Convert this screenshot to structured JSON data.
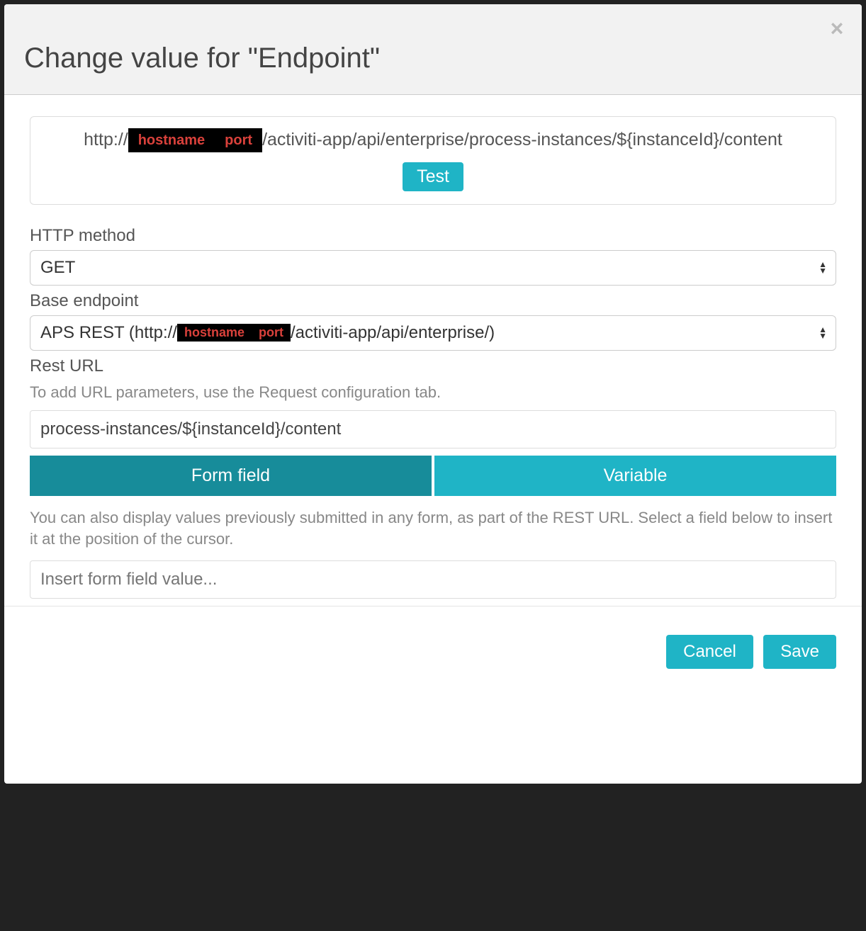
{
  "modal": {
    "title": "Change value for \"Endpoint\"",
    "url_prefix": "http://",
    "redacted_host_label": "hostname",
    "redacted_port_label": "port",
    "url_path_1": "/activiti-app/api/enterprise/process-instances/${instanceId}/content",
    "test_label": "Test",
    "http_method": {
      "label": "HTTP method",
      "value": "GET"
    },
    "base_endpoint": {
      "label": "Base endpoint",
      "value_prefix": "APS REST (http://",
      "value_suffix": "/activiti-app/api/enterprise/)"
    },
    "rest_url": {
      "label": "Rest URL",
      "helper": "To add URL parameters, use the Request configuration tab.",
      "value": "process-instances/${instanceId}/content"
    },
    "tabs": {
      "form_field": "Form field",
      "variable": "Variable"
    },
    "body_note": "You can also display values previously submitted in any form, as part of the REST URL. Select a field below to insert it at the position of the cursor.",
    "insert_placeholder": "Insert form field value...",
    "footer": {
      "cancel": "Cancel",
      "save": "Save"
    }
  }
}
